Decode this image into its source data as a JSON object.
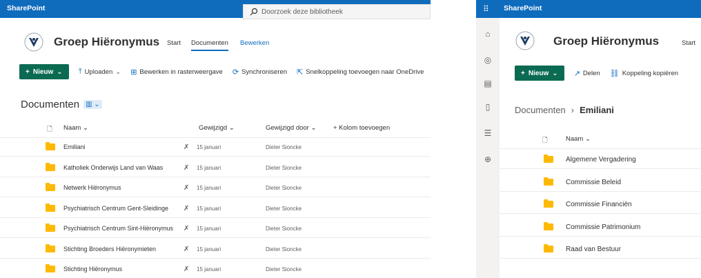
{
  "left": {
    "brand": "SharePoint",
    "search_placeholder": "Doorzoek deze bibliotheek",
    "site_title": "Groep Hiëronymus",
    "nav": [
      "Start",
      "Documenten",
      "Bewerken"
    ],
    "commands": {
      "new": "Nieuw",
      "upload": "Uploaden",
      "grid": "Bewerken in rasterweergave",
      "sync": "Synchroniseren",
      "shortcut": "Snelkoppeling toevoegen naar OneDrive"
    },
    "library_title": "Documenten",
    "columns": {
      "name": "Naam",
      "modified": "Gewijzigd",
      "modified_by": "Gewijzigd door",
      "add_column": "+ Kolom toevoegen"
    },
    "rows": [
      {
        "name": "Emiliani",
        "modified": "15 januari",
        "by": "Dieter Sioncke"
      },
      {
        "name": "Katholiek Onderwijs Land van Waas",
        "modified": "15 januari",
        "by": "Dieter Sioncke"
      },
      {
        "name": "Netwerk Hiëronymus",
        "modified": "15 januari",
        "by": "Dieter Sioncke"
      },
      {
        "name": "Psychiatrisch Centrum Gent-Sleidinge",
        "modified": "15 januari",
        "by": "Dieter Sioncke"
      },
      {
        "name": "Psychiatrisch Centrum Sint-Hiëronymus",
        "modified": "15 januari",
        "by": "Dieter Sioncke"
      },
      {
        "name": "Stichting Broeders Hiëronymieten",
        "modified": "15 januari",
        "by": "Dieter Sioncke"
      },
      {
        "name": "Stichting Hiëronymus",
        "modified": "15 januari",
        "by": "Dieter Sioncke"
      }
    ]
  },
  "right": {
    "brand": "SharePoint",
    "site_title": "Groep Hiëronymus",
    "nav": [
      "Start"
    ],
    "commands": {
      "new": "Nieuw",
      "share": "Delen",
      "copy_link": "Koppeling kopiëren"
    },
    "breadcrumb": {
      "root": "Documenten",
      "current": "Emiliani"
    },
    "column_name": "Naam",
    "rows": [
      {
        "name": "Algemene Vergadering"
      },
      {
        "name": "Commissie Beleid"
      },
      {
        "name": "Commissie Financiën"
      },
      {
        "name": "Commissie Patrimonium"
      },
      {
        "name": "Raad van Bestuur"
      }
    ]
  },
  "icons": {
    "search": "search-icon",
    "folder": "folder-icon",
    "pin": "pin-icon",
    "waffle": "waffle-icon"
  },
  "colors": {
    "suitebar": "#0f6cbd",
    "new_button": "#0b6a52",
    "folder": "#ffb900"
  }
}
